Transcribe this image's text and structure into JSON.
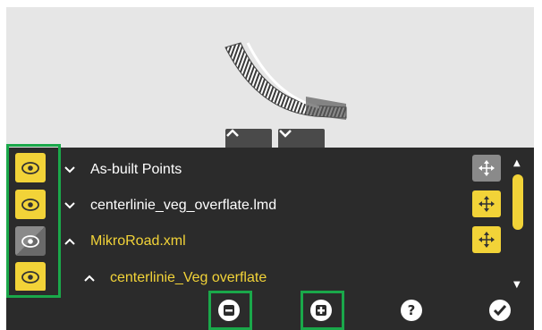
{
  "tree": {
    "rows": [
      {
        "label": "As-built Points",
        "expanded": true,
        "highlighted": false
      },
      {
        "label": "centerlinie_veg_overflate.lmd",
        "expanded": true,
        "highlighted": false
      },
      {
        "label": "MikroRoad.xml",
        "expanded": false,
        "highlighted": true
      },
      {
        "label": "centerlinie_Veg overflate",
        "expanded": false,
        "highlighted": true
      }
    ]
  },
  "visibility": [
    "visible",
    "visible",
    "hidden",
    "visible"
  ],
  "icons": {
    "visibility": "eye-icon",
    "move": "move-arrows-icon",
    "collapse_all": "minus-circle-icon",
    "expand_all": "plus-circle-icon",
    "help": "help-icon",
    "confirm": "check-icon"
  },
  "colors": {
    "accent": "#f2d338",
    "panel": "#2b2b2b",
    "highlight_border": "#1aa84a",
    "preview_bg": "#e6e6e6"
  }
}
